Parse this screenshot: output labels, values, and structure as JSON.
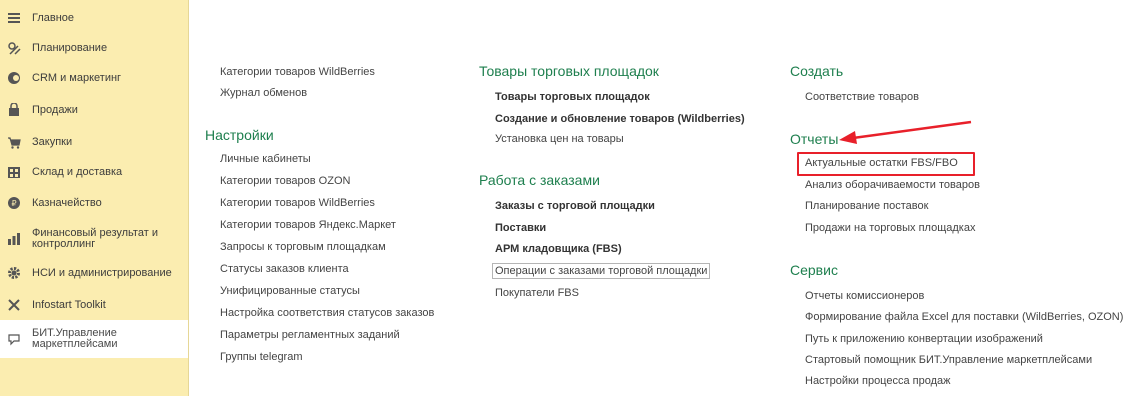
{
  "sidebar": {
    "items": [
      {
        "label": "Главное",
        "icon": "menu-lines-icon"
      },
      {
        "label": "Планирование",
        "icon": "planning-icon"
      },
      {
        "label": "CRM и маркетинг",
        "icon": "crm-icon"
      },
      {
        "label": "Продажи",
        "icon": "shopping-bag-icon"
      },
      {
        "label": "Закупки",
        "icon": "cart-icon"
      },
      {
        "label": "Склад и доставка",
        "icon": "warehouse-icon"
      },
      {
        "label": "Казначейство",
        "icon": "money-icon"
      },
      {
        "label": "Финансовый результат и контроллинг",
        "icon": "bar-chart-icon"
      },
      {
        "label": "НСИ и администрирование",
        "icon": "gear-icon"
      },
      {
        "label": "Infostart Toolkit",
        "icon": "tools-icon"
      },
      {
        "label": "БИТ.Управление маркетплейсами",
        "icon": "marketplace-icon"
      }
    ]
  },
  "col1": {
    "top_links": [
      "Категории товаров WildBerries",
      "Журнал обменов"
    ],
    "settings_title": "Настройки",
    "settings_links": [
      "Личные кабинеты",
      "Категории товаров OZON",
      "Категории товаров WildBerries",
      "Категории товаров Яндекс.Маркет",
      "Запросы к торговым площадкам",
      "Статусы заказов клиента",
      "Унифицированные статусы",
      "Настройка соответствия статусов заказов",
      "Параметры регламентных заданий",
      "Группы telegram"
    ]
  },
  "col2": {
    "goods_title": "Товары торговых площадок",
    "goods_links": [
      "Товары торговых площадок",
      "Создание и обновление товаров (Wildberries)",
      "Установка цен на товары"
    ],
    "orders_title": "Работа с заказами",
    "orders_links": [
      "Заказы с торговой площадки",
      "Поставки",
      "АРМ кладовщика (FBS)",
      "Операции с заказами торговой площадки",
      "Покупатели FBS"
    ]
  },
  "col3": {
    "create_title": "Создать",
    "create_links": [
      "Соответствие товаров"
    ],
    "reports_title": "Отчеты",
    "reports_links": [
      "Актуальные остатки FBS/FBO",
      "Анализ оборачиваемости товаров",
      "Планирование поставок",
      "Продажи на торговых площадках"
    ],
    "service_title": "Сервис",
    "service_links": [
      "Отчеты комиссионеров",
      "Формирование файла Excel для поставки (WildBerries, OZON)",
      "Путь к приложению конвертации изображений",
      "Стартовый помощник БИТ.Управление маркетплейсами",
      "Настройки процесса продаж"
    ]
  },
  "colors": {
    "sidebar_bg": "#fbedb0",
    "section_title": "#1e7f4e",
    "highlight": "#e8202a"
  }
}
